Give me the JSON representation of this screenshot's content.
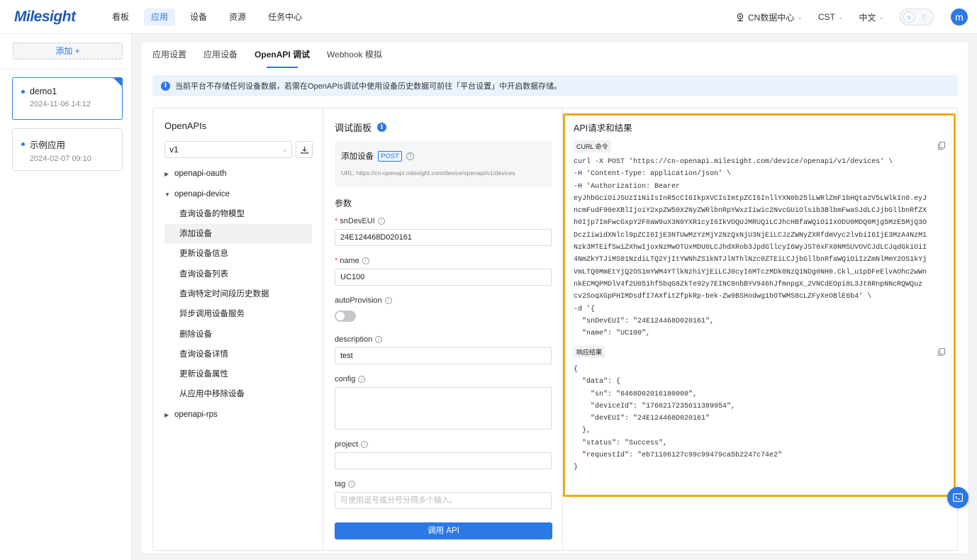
{
  "brand": {
    "logo_text": "Milesight",
    "accent": "#2b79e5",
    "highlight": "#f0a81a"
  },
  "nav": {
    "items": [
      {
        "label": "看板",
        "active": false
      },
      {
        "label": "应用",
        "active": true
      },
      {
        "label": "设备",
        "active": false
      },
      {
        "label": "资源",
        "active": false
      },
      {
        "label": "任务中心",
        "active": false
      }
    ]
  },
  "topright": {
    "region": "CN数据中心",
    "timezone": "CST",
    "language": "中文",
    "avatar_letter": "m"
  },
  "sidebar": {
    "add_label": "添加 +",
    "apps": [
      {
        "name": "demo1",
        "date": "2024-11-06 14:12",
        "selected": true
      },
      {
        "name": "示例应用",
        "date": "2024-02-07 09:10",
        "selected": false
      }
    ]
  },
  "tabs": [
    {
      "label": "应用设置",
      "active": false
    },
    {
      "label": "应用设备",
      "active": false
    },
    {
      "label": "OpenAPI 调试",
      "active": true
    },
    {
      "label": "Webhook 模拟",
      "active": false
    }
  ],
  "notice": "当前平台不存储任何设备数据，若需在OpenAPIs调试中使用设备历史数据可前往「平台设置」中开启数据存储。",
  "openapis": {
    "title": "OpenAPIs",
    "version": "v1",
    "groups": [
      {
        "label": "openapi-oauth",
        "expanded": false
      },
      {
        "label": "openapi-device",
        "expanded": true
      },
      {
        "label": "openapi-rps",
        "expanded": false
      }
    ],
    "device_items": [
      "查询设备的物模型",
      "添加设备",
      "更新设备信息",
      "查询设备列表",
      "查询特定时间段历史数据",
      "异步调用设备服务",
      "删除设备",
      "查询设备详情",
      "更新设备属性",
      "从应用中移除设备"
    ]
  },
  "debug": {
    "title": "调试面板",
    "api_name": "添加设备",
    "method": "POST",
    "url": "URL:  https://cn-openapi.milesight.com/device/openapi/v1/devices",
    "params_label": "参数",
    "fields": {
      "sn_label": "snDevEUI",
      "sn_value": "24E124468D020161",
      "name_label": "name",
      "name_value": "UC100",
      "auto_label": "autoProvision",
      "desc_label": "description",
      "desc_value": "test",
      "config_label": "config",
      "project_label": "project",
      "tag_label": "tag",
      "tag_placeholder": "可使用逗号或分号分隔多个输入。"
    },
    "call_button": "调用 API"
  },
  "result": {
    "title": "API请求和结果",
    "curl_badge": "CURL 命令",
    "curl_lines": [
      "curl -X POST 'https://cn-openapi.milesight.com/device/openapi/v1/devices' \\",
      "-H 'Content-Type: application/json' \\",
      "-H 'Authorization: Bearer",
      "eyJhbGciOiJSUzI1NiIsInR5cCI6IkpXVCIsImtpZCI6InllYXN0b25lLWRlZmF1bHQta2V5LWlkIn0.eyJ",
      "ncmFudF90eXBlIjoiY2xpZW50X2NyZWRlbnRpYWxzIiwic2NvcGUiOlsib3BlbmFwaSJdLCJjbGllbnRfZX",
      "h0Ijp7ImFwcGxpY2F0aW9uX3N0YXR1cyI6IkVOQUJMRUQiLCJhcHBfaWQiOiIxODU0MDQ0Mjg5MzE5MjQ3O",
      "DczIiwidXNlcl9pZCI6IjE3NTUwMzYzMjY2NzQxNjU3NjEiLCJzZWNyZXRfdmVyc2lvbiI6IjE3MzA4NzM1",
      "Nzk3MTEifSwiZXhwIjoxNzMwOTUxMDU0LCJhdXRob3JpdGllcyI6WyJST0xFX0NMSUVOVCJdLCJqdGkiOiI",
      "4NmZkYTJiMS01NzdiLTQ2YjItYWNhZS1kNTJlNThlNzc0ZTEiLCJjbGllbnRfaWQiOiIzZmNlMmY2OS1kYj",
      "VmLTQ0MmEtYjQ2OS1mYWM4YTlkNzhiYjEiLCJ0cyI6MTczMDk0NzQ1NDg0NH0.Ckl_u1pDFeElvAOhc2wWn",
      "nkECMQPMDlV4f2U051hf5bqG8ZkTe92y7EINC0nbBYV946hJfmnpgX_2VNCdEOpi8L3Jt8RnpNNcRQWQuz",
      "cv2SoqXGpPHIMDsdfI7AXfitZfpkRp-bek-Zw9BSHodwg1bOTWMS8cLZFyXeOBlE6b4' \\",
      "-d '{",
      "  \"snDevEUI\": \"24E124468D020161\",",
      "  \"name\": \"UC100\","
    ],
    "response_badge": "响应结果",
    "response_lines": [
      "{",
      "  \"data\": {",
      "    \"sn\": \"6468D02016180000\",",
      "    \"deviceId\": \"1760217235611389954\",",
      "    \"devEUI\": \"24E124468D020161\"",
      "  },",
      "  \"status\": \"Success\",",
      "  \"requestId\": \"eb71106127c99c99479ca5b2247c74e2\"",
      "}"
    ]
  }
}
